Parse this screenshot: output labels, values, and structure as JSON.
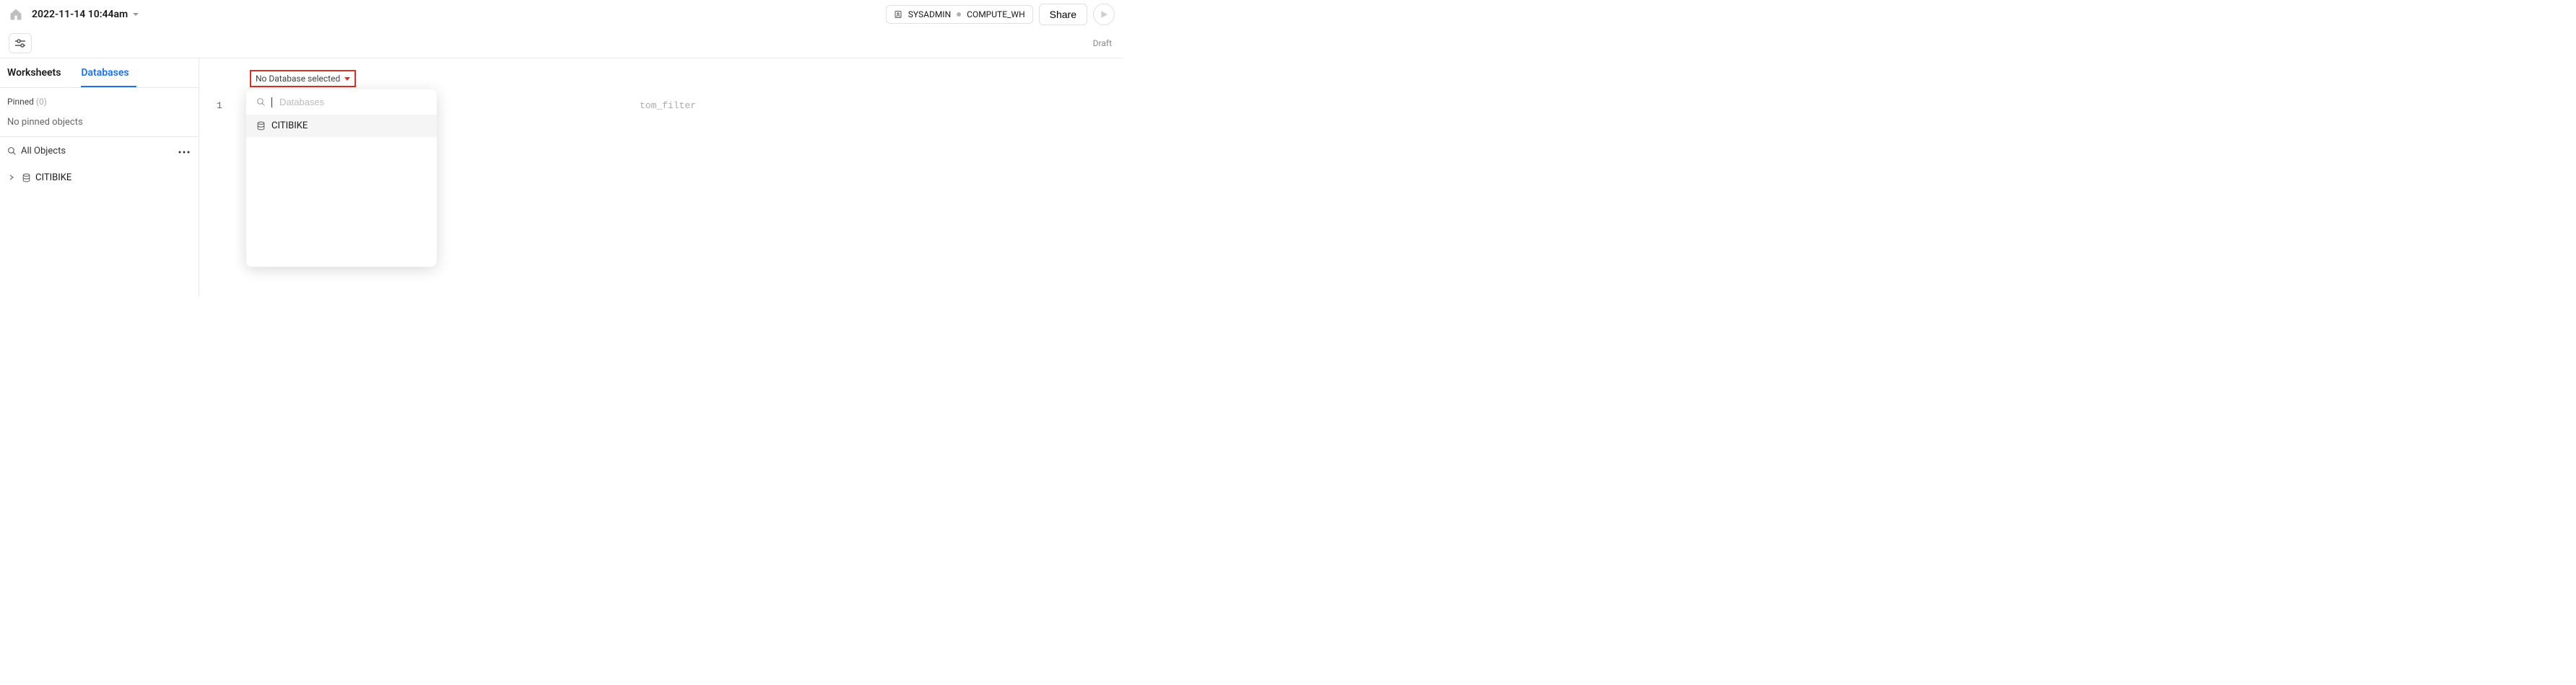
{
  "header": {
    "title": "2022-11-14 10:44am",
    "role": "SYSADMIN",
    "warehouse": "COMPUTE_WH",
    "share_label": "Share",
    "draft_label": "Draft"
  },
  "sidebar": {
    "tabs": [
      {
        "label": "Worksheets"
      },
      {
        "label": "Databases"
      }
    ],
    "pinned_label": "Pinned",
    "pinned_count": "(0)",
    "no_pinned_text": "No pinned objects",
    "all_objects_label": "All Objects",
    "tree_items": [
      {
        "label": "CITIBIKE"
      }
    ]
  },
  "editor": {
    "db_selector_label": "No Database selected",
    "line_number": "1",
    "code_fragment": "tom_filter",
    "dropdown": {
      "search_placeholder": "Databases",
      "items": [
        {
          "label": "CITIBIKE"
        }
      ]
    }
  }
}
